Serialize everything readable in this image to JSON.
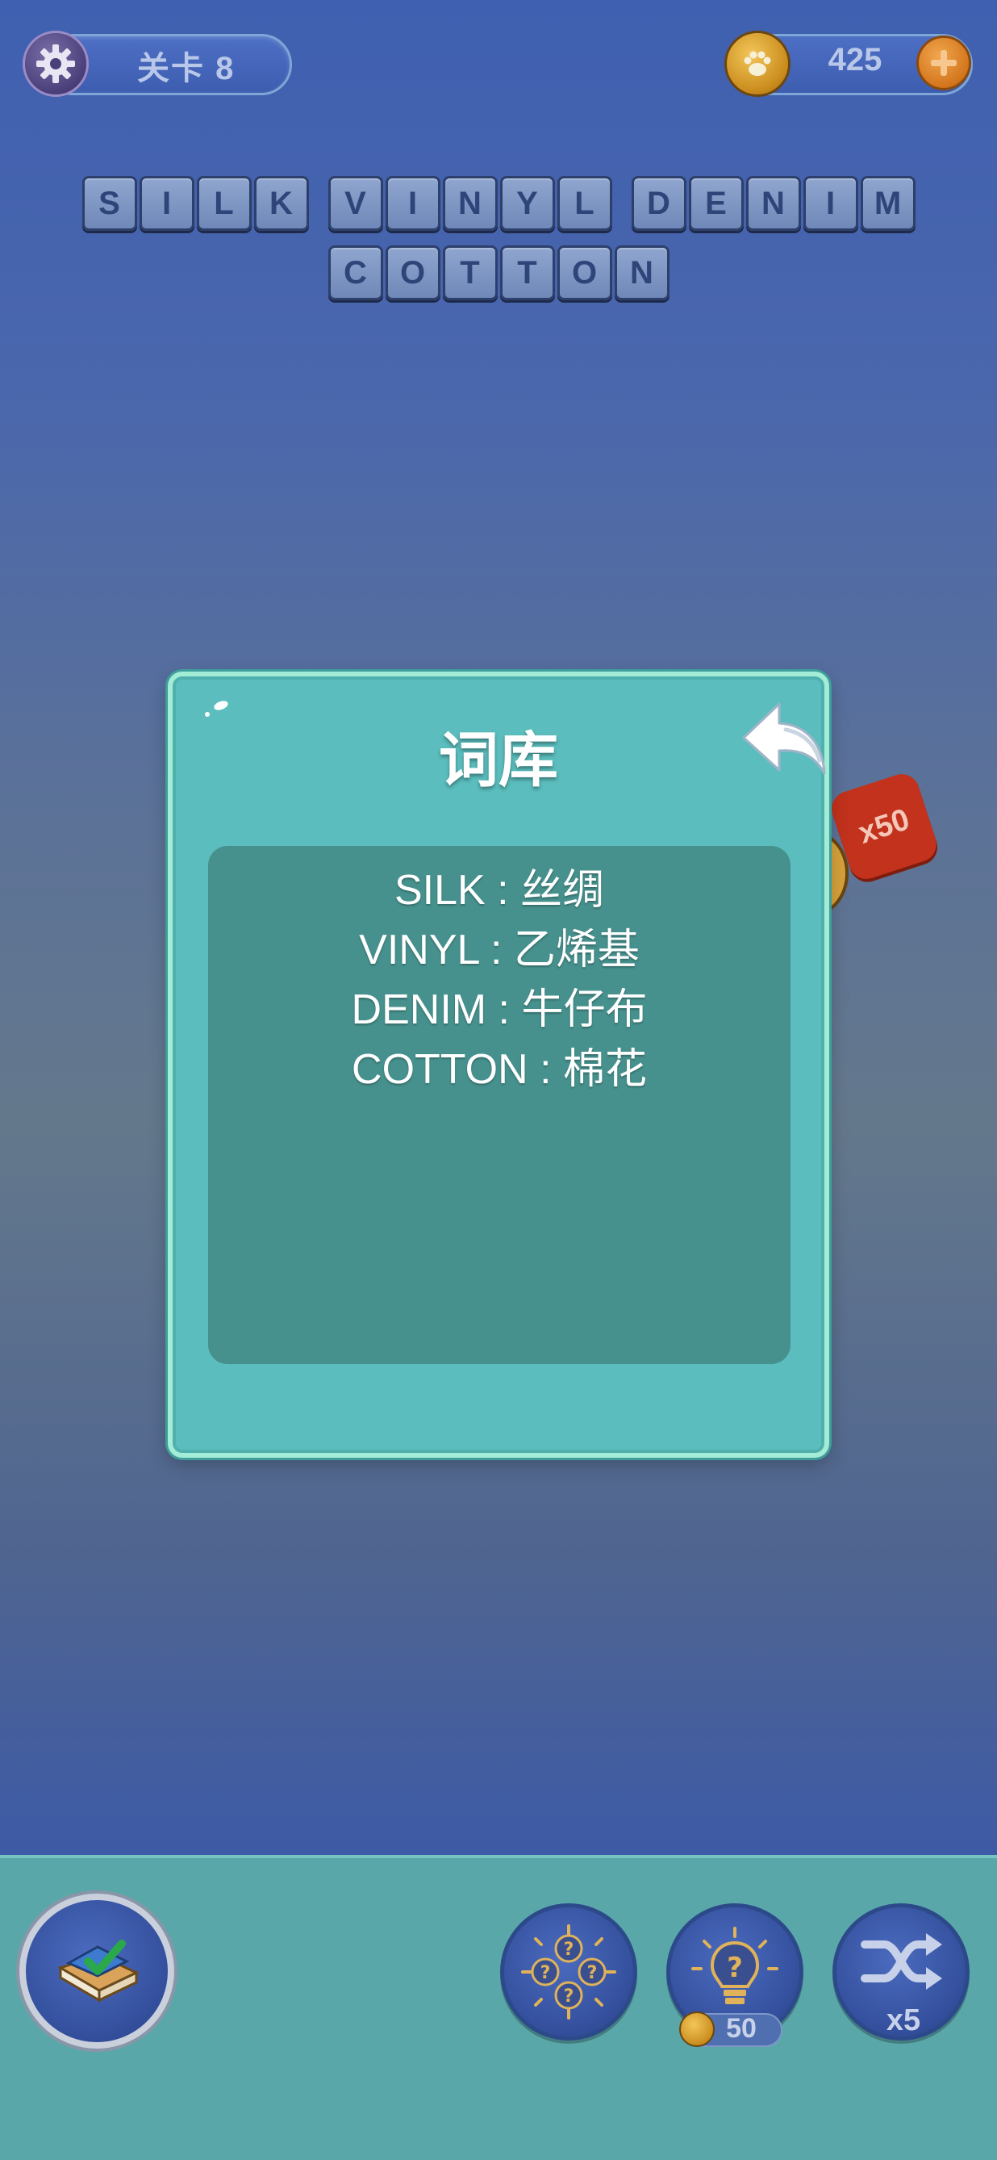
{
  "header": {
    "level_label": "关卡 8",
    "coins": "425"
  },
  "puzzle": {
    "row1": [
      [
        "S",
        "I",
        "L",
        "K"
      ],
      [
        "V",
        "I",
        "N",
        "Y",
        "L"
      ],
      [
        "D",
        "E",
        "N",
        "I",
        "M"
      ]
    ],
    "row2": [
      [
        "C",
        "O",
        "T",
        "T",
        "O",
        "N"
      ]
    ]
  },
  "background_badge": {
    "label": "x50"
  },
  "dictionary_dialog": {
    "title": "词库",
    "entries": [
      "SILK : 丝绸",
      "VINYL : 乙烯基",
      "DENIM : 牛仔布",
      "COTTON : 棉花"
    ]
  },
  "tools": {
    "hint_cost": "50",
    "shuffle_count": "x5"
  },
  "colors": {
    "dialog_bg": "#5bbdbd",
    "list_bg": "#46918d",
    "bottom_panel": "#5aa7aa",
    "badge_red": "#c2321c"
  }
}
